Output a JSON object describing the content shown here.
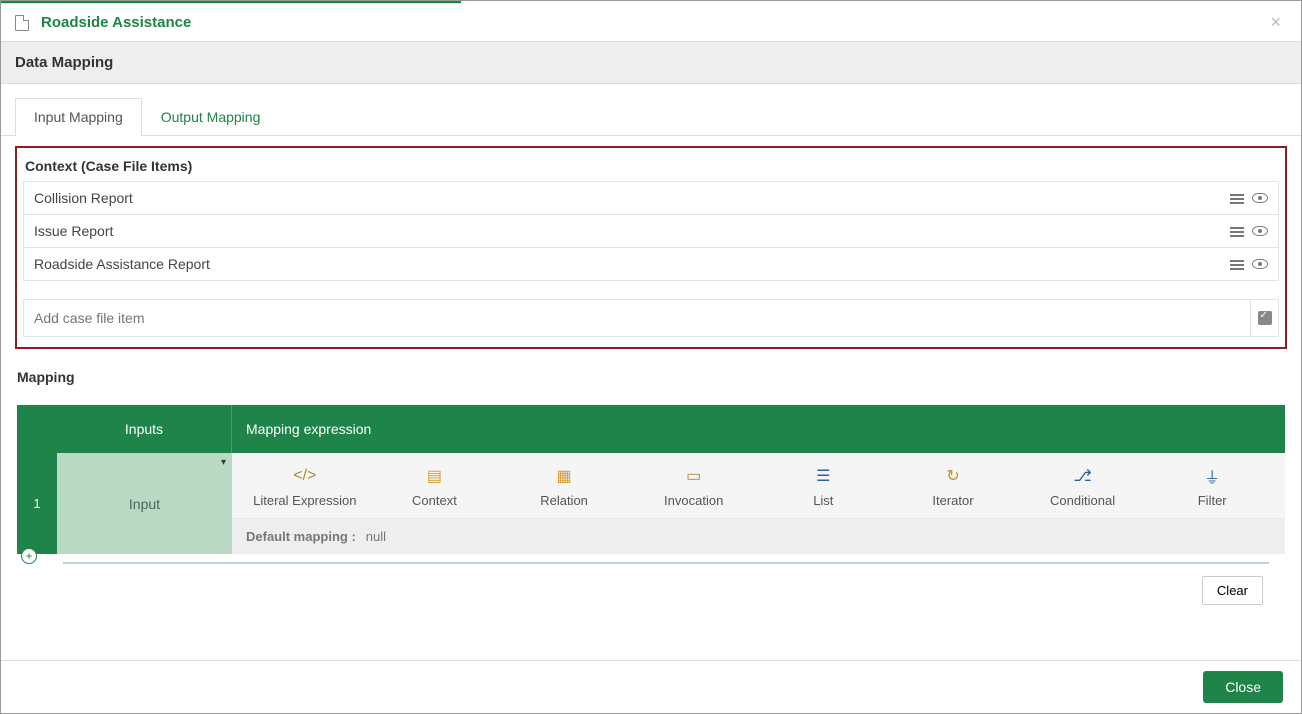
{
  "title": "Roadside Assistance",
  "section": "Data Mapping",
  "tabs": {
    "input": "Input Mapping",
    "output": "Output Mapping"
  },
  "context": {
    "heading": "Context (Case File Items)",
    "items": [
      "Collision Report",
      "Issue Report",
      "Roadside Assistance Report"
    ],
    "add_placeholder": "Add case file item"
  },
  "mapping": {
    "heading": "Mapping",
    "col_inputs": "Inputs",
    "col_expr": "Mapping expression",
    "row_num": "1",
    "input_label": "Input",
    "tools": {
      "literal": "Literal Expression",
      "context": "Context",
      "relation": "Relation",
      "invocation": "Invocation",
      "list": "List",
      "iterator": "Iterator",
      "conditional": "Conditional",
      "filter": "Filter"
    },
    "default_label": "Default mapping :",
    "default_value": "null"
  },
  "buttons": {
    "clear": "Clear",
    "close": "Close"
  }
}
